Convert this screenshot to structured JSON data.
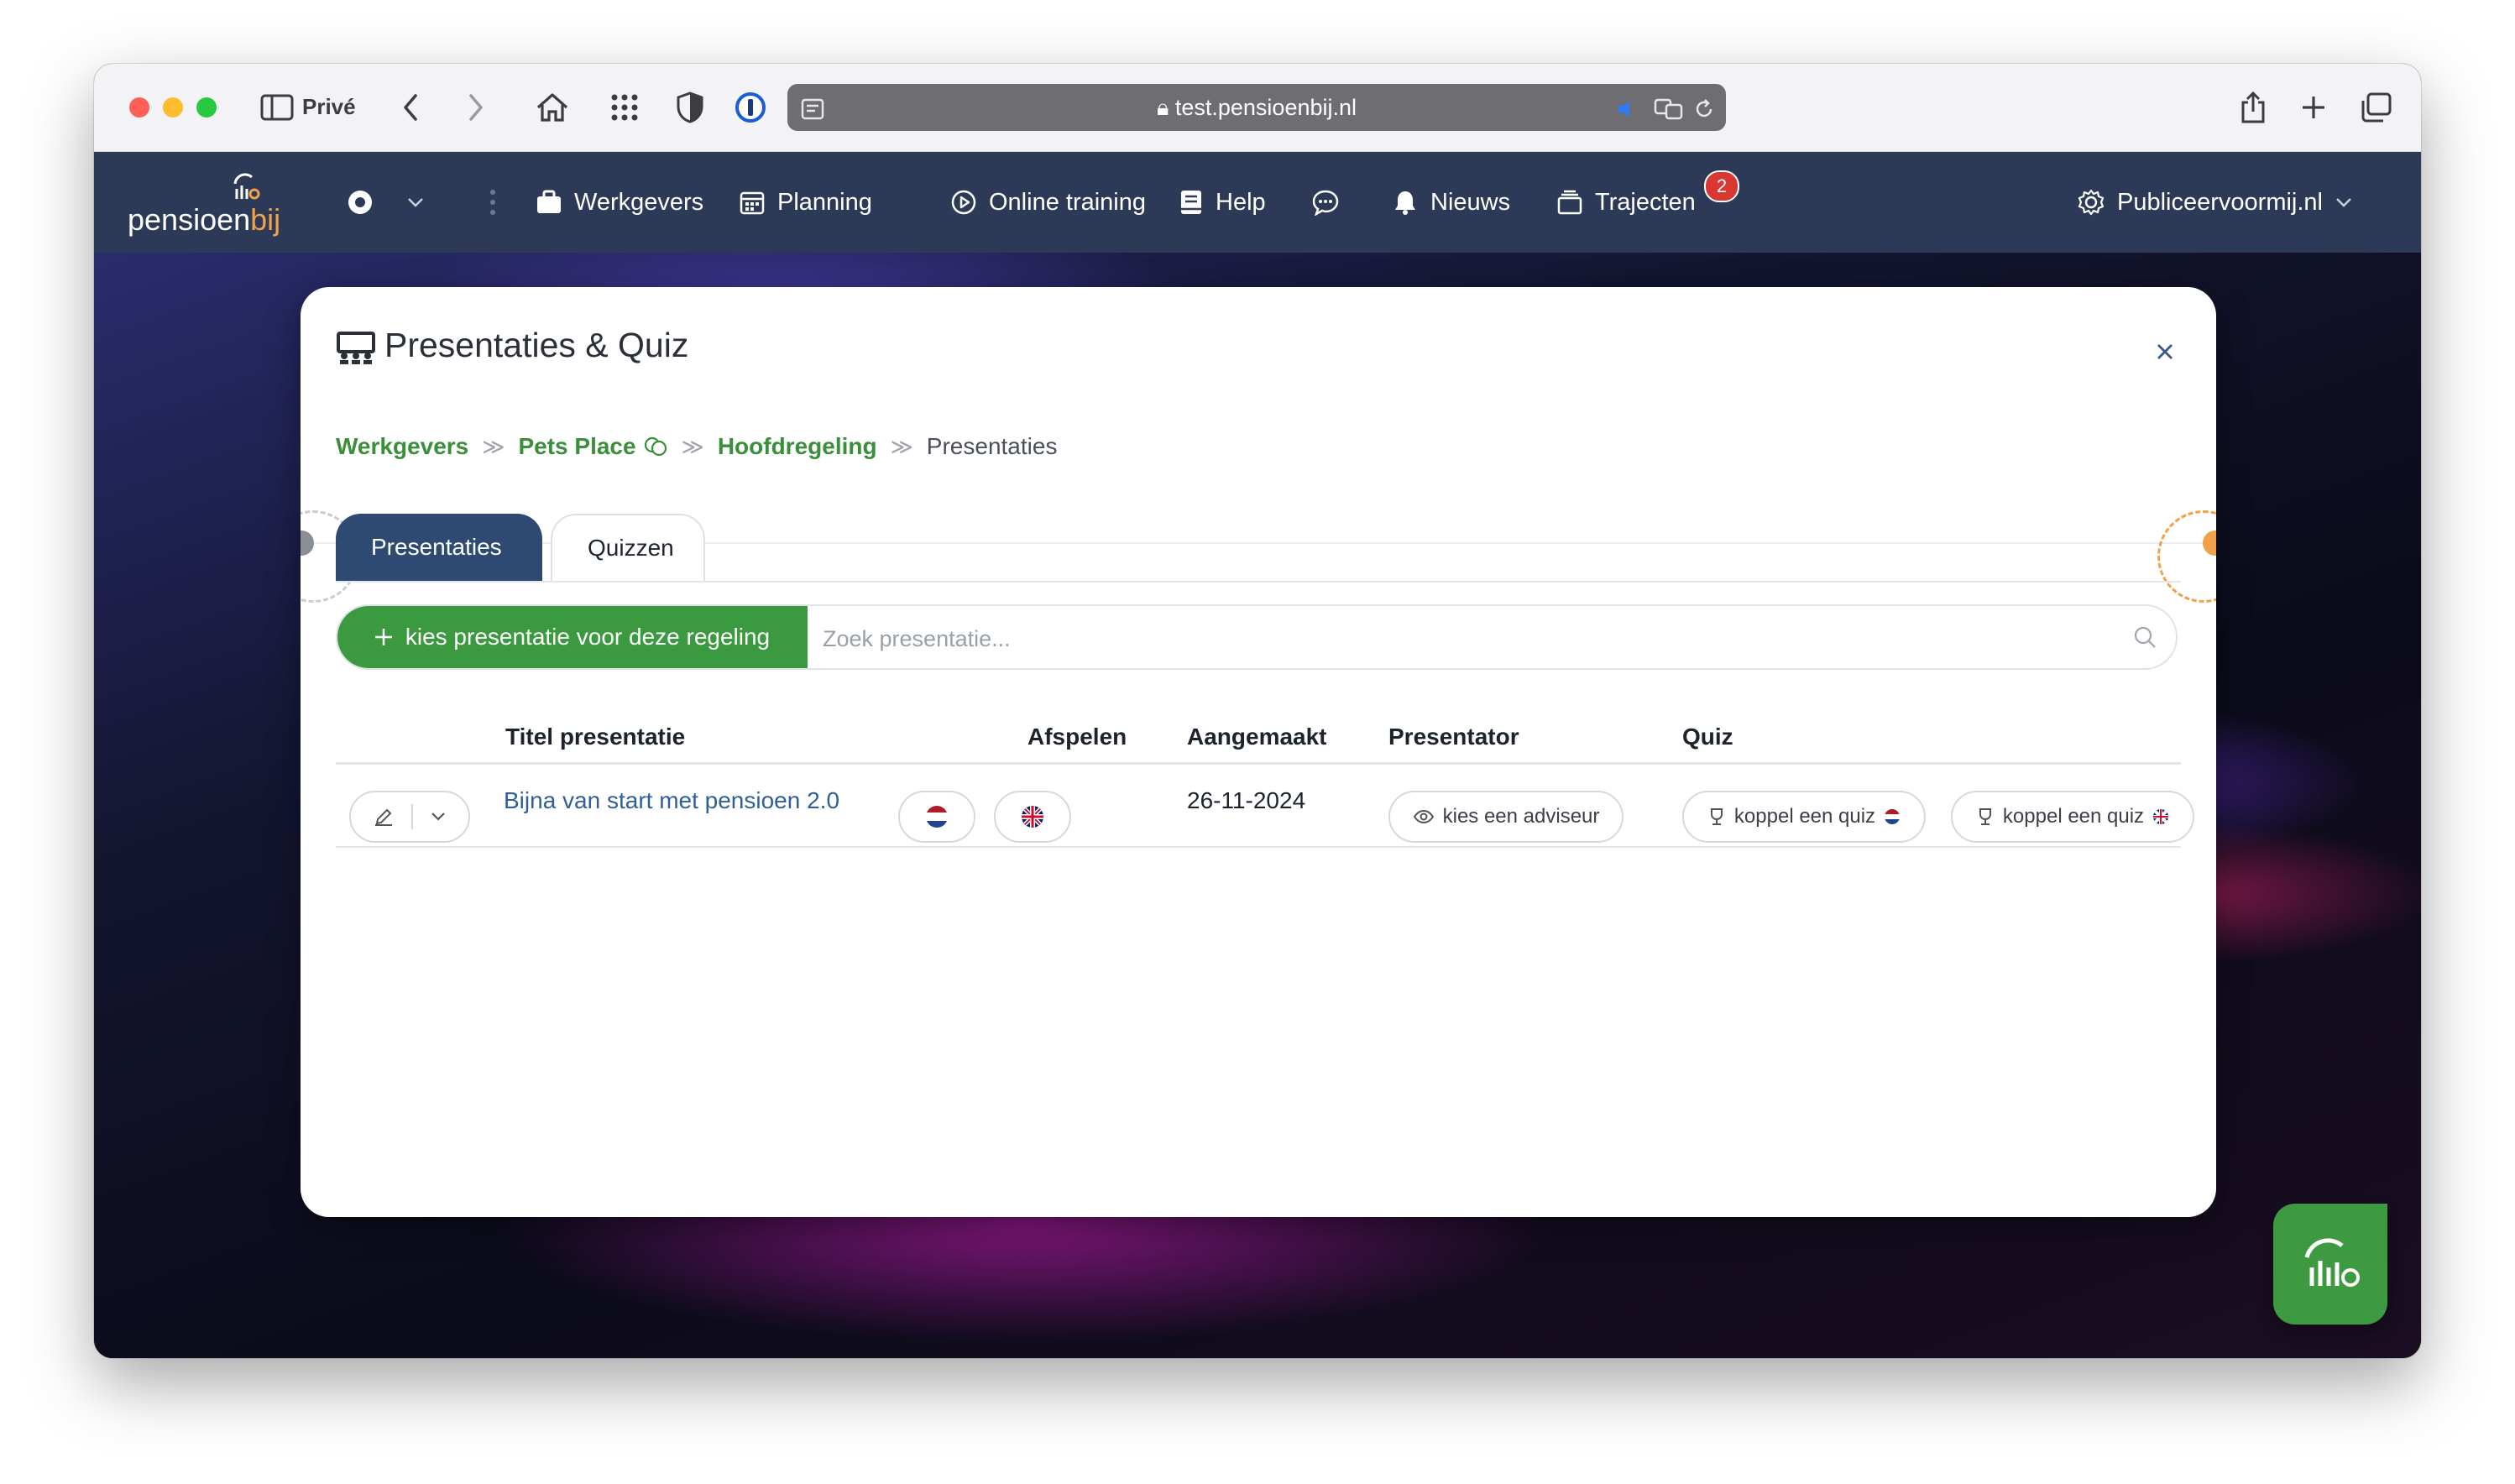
{
  "browser": {
    "private_label": "Privé",
    "url": "test.pensioenbij.nl"
  },
  "app": {
    "brand_part1": "pensioen",
    "brand_part2": "bij",
    "nav": {
      "werkgevers": "Werkgevers",
      "planning": "Planning",
      "online_training": "Online training",
      "help": "Help",
      "nieuws": "Nieuws",
      "trajecten": "Trajecten",
      "trajecten_badge": "2",
      "site": "Publiceervoormij.nl"
    }
  },
  "modal": {
    "title": "Presentaties & Quiz",
    "breadcrumb": {
      "werkgevers": "Werkgevers",
      "pets_place": "Pets Place",
      "hoofdregeling": "Hoofdregeling",
      "current": "Presentaties"
    },
    "tabs": {
      "presentaties": "Presentaties",
      "quizzen": "Quizzen"
    },
    "add_button": "kies presentatie voor deze regeling",
    "search_placeholder": "Zoek presentatie...",
    "table": {
      "headers": {
        "title": "Titel presentatie",
        "play": "Afspelen",
        "created": "Aangemaakt",
        "presenter": "Presentator",
        "quiz": "Quiz"
      },
      "rows": [
        {
          "title": "Bijna van start met pensioen 2.0",
          "created": "26-11-2024",
          "presenter_button": "kies een adviseur",
          "quiz_nl_button": "koppel een quiz",
          "quiz_en_button": "koppel een quiz"
        }
      ]
    }
  },
  "colors": {
    "nav_bg": "#2c3a57",
    "accent_green": "#3b9a3f",
    "tab_active": "#2e4a72",
    "link_blue": "#2f5f9a",
    "badge_red": "#d9372f"
  }
}
